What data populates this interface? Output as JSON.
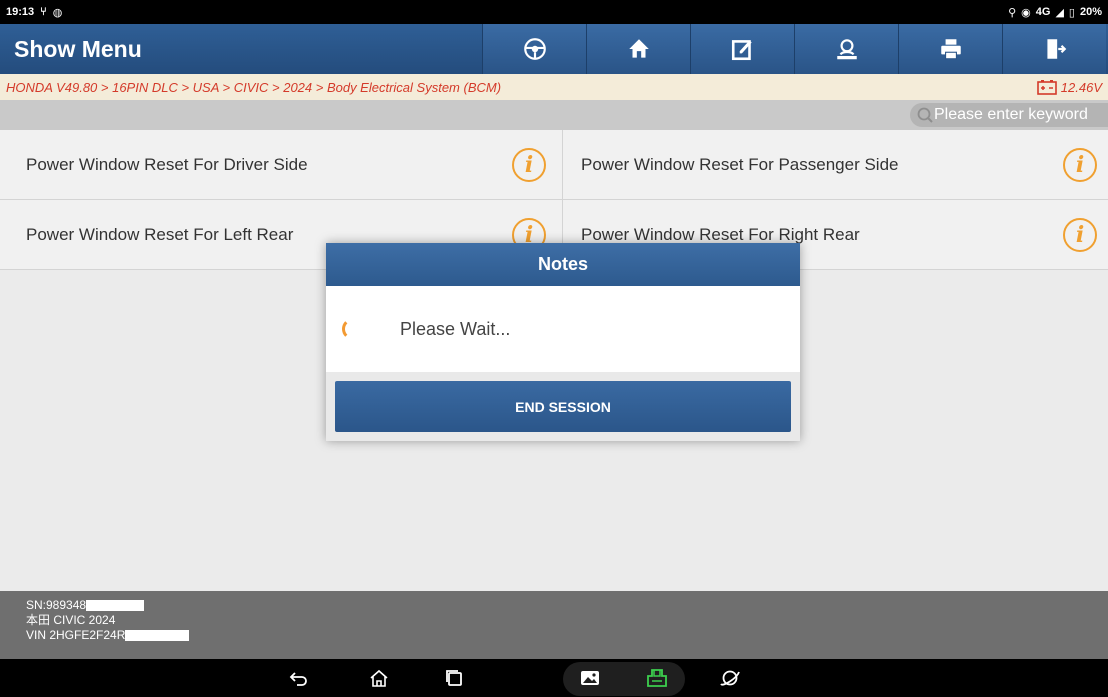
{
  "status_bar": {
    "time": "19:13",
    "right_text": "4G",
    "battery": "20%"
  },
  "header": {
    "title": "Show Menu",
    "tools": [
      {
        "icon": "steering-wheel-icon"
      },
      {
        "icon": "home-icon"
      },
      {
        "icon": "edit-report-icon"
      },
      {
        "icon": "user-support-icon"
      },
      {
        "icon": "printer-icon"
      },
      {
        "icon": "exit-icon"
      }
    ]
  },
  "breadcrumb": {
    "path": "HONDA V49.80 > 16PIN DLC > USA > CIVIC > 2024 > Body Electrical System (BCM)",
    "voltage": "12.46V"
  },
  "search": {
    "placeholder": "Please enter keyword"
  },
  "menu": {
    "items": [
      {
        "label": "Power Window Reset For Driver Side"
      },
      {
        "label": "Power Window Reset For Passenger Side"
      },
      {
        "label": "Power Window Reset For Left Rear"
      },
      {
        "label": "Power Window Reset For Right Rear"
      }
    ]
  },
  "footer": {
    "sn": "SN:989348",
    "model": "本田 CIVIC 2024",
    "vin": "VIN 2HGFE2F24R"
  },
  "dialog": {
    "title": "Notes",
    "message": "Please Wait...",
    "button": "END SESSION"
  },
  "colors": {
    "header_blue": "#2a5487",
    "breadcrumb_red": "#d43a2a",
    "info_orange": "#f0a030"
  }
}
